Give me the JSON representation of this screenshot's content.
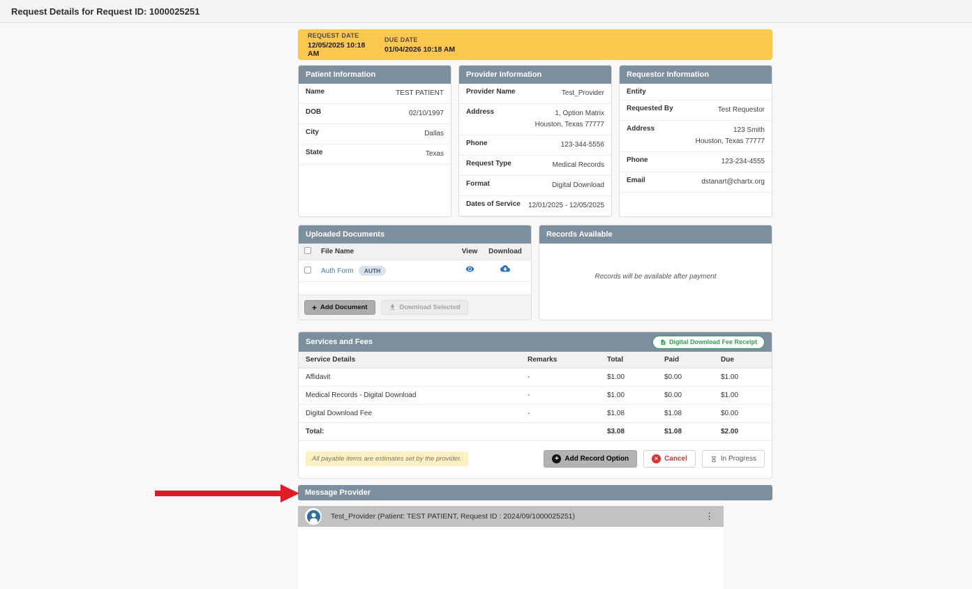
{
  "page": {
    "title": "Request Details for Request ID: 1000025251"
  },
  "banner": {
    "request_date_label": "REQUEST DATE",
    "request_date_value": "12/05/2025 10:18 AM",
    "due_date_label": "DUE DATE",
    "due_date_value": "01/04/2026 10:18 AM"
  },
  "patient_info": {
    "title": "Patient Information",
    "rows": [
      {
        "label": "Name",
        "value": "TEST PATIENT"
      },
      {
        "label": "DOB",
        "value": "02/10/1997"
      },
      {
        "label": "City",
        "value": "Dallas"
      },
      {
        "label": "State",
        "value": "Texas"
      }
    ]
  },
  "provider_info": {
    "title": "Provider Information",
    "rows": [
      {
        "label": "Provider Name",
        "value": "Test_Provider"
      },
      {
        "label": "Address",
        "value": "1, Option Matrix",
        "value2": "Houston, Texas 77777"
      },
      {
        "label": "Phone",
        "value": "123-344-5556"
      },
      {
        "label": "Request Type",
        "value": "Medical Records"
      },
      {
        "label": "Format",
        "value": "Digital Download"
      },
      {
        "label": "Dates of Service",
        "value": "12/01/2025 - 12/05/2025"
      }
    ]
  },
  "requestor_info": {
    "title": "Requestor Information",
    "rows": [
      {
        "label": "Entity",
        "value": ""
      },
      {
        "label": "Requested By",
        "value": "Test Requestor"
      },
      {
        "label": "Address",
        "value": "123 Smith",
        "value2": "Houston, Texas 77777"
      },
      {
        "label": "Phone",
        "value": "123-234-4555"
      },
      {
        "label": "Email",
        "value": "dstanart@chartx.org"
      }
    ]
  },
  "uploaded_documents": {
    "title": "Uploaded Documents",
    "columns": {
      "file_name": "File Name",
      "view": "View",
      "download": "Download"
    },
    "rows": [
      {
        "file_name": "Auth Form",
        "badge": "AUTH"
      }
    ],
    "add_document_label": "Add Document",
    "download_selected_label": "Download Selected"
  },
  "records_available": {
    "title": "Records Available",
    "empty_message": "Records will be available after payment"
  },
  "services_and_fees": {
    "title": "Services and Fees",
    "receipt_button_label": "Digital Download Fee Receipt",
    "columns": {
      "service": "Service Details",
      "remarks": "Remarks",
      "total": "Total",
      "paid": "Paid",
      "due": "Due"
    },
    "rows": [
      {
        "service": "Affidavit",
        "remarks": "-",
        "total": "$1.00",
        "paid": "$0.00",
        "due": "$1.00"
      },
      {
        "service": "Medical Records - Digital Download",
        "remarks": "-",
        "total": "$1.00",
        "paid": "$0.00",
        "due": "$1.00"
      },
      {
        "service": "Digital Download Fee",
        "remarks": "-",
        "total": "$1.08",
        "paid": "$1.08",
        "due": "$0.00"
      }
    ],
    "total_row": {
      "label": "Total:",
      "total": "$3.08",
      "paid": "$1.08",
      "due": "$2.00"
    },
    "note": "All payable items are estimates set by the provider.",
    "add_record_option_label": "Add Record Option",
    "cancel_label": "Cancel",
    "in_progress_label": "In Progress"
  },
  "message_provider": {
    "title": "Message Provider",
    "chat_header": "Test_Provider (Patient: TEST PATIENT, Request ID : 2024/09/1000025251)"
  },
  "icons": {
    "view": "eye",
    "download": "cloud-download",
    "download_selected": "download-tray",
    "add": "plus-circle",
    "cancel": "x-circle",
    "in_progress": "hourglass",
    "receipt": "document",
    "avatar": "person",
    "menu": "kebab-vertical",
    "annotation": "red-arrow-right",
    "kebab_glyph": "⋮",
    "plus_glyph": "+",
    "x_glyph": "×"
  },
  "colors": {
    "section_header": "#7B8F9E",
    "banner_yellow": "#FBC84D",
    "accent_green": "#2DA44E",
    "accent_red": "#E03131",
    "link_blue": "#3C7FC0",
    "arrow_red": "#E01B24",
    "chat_header_gray": "#C2C2C2"
  }
}
